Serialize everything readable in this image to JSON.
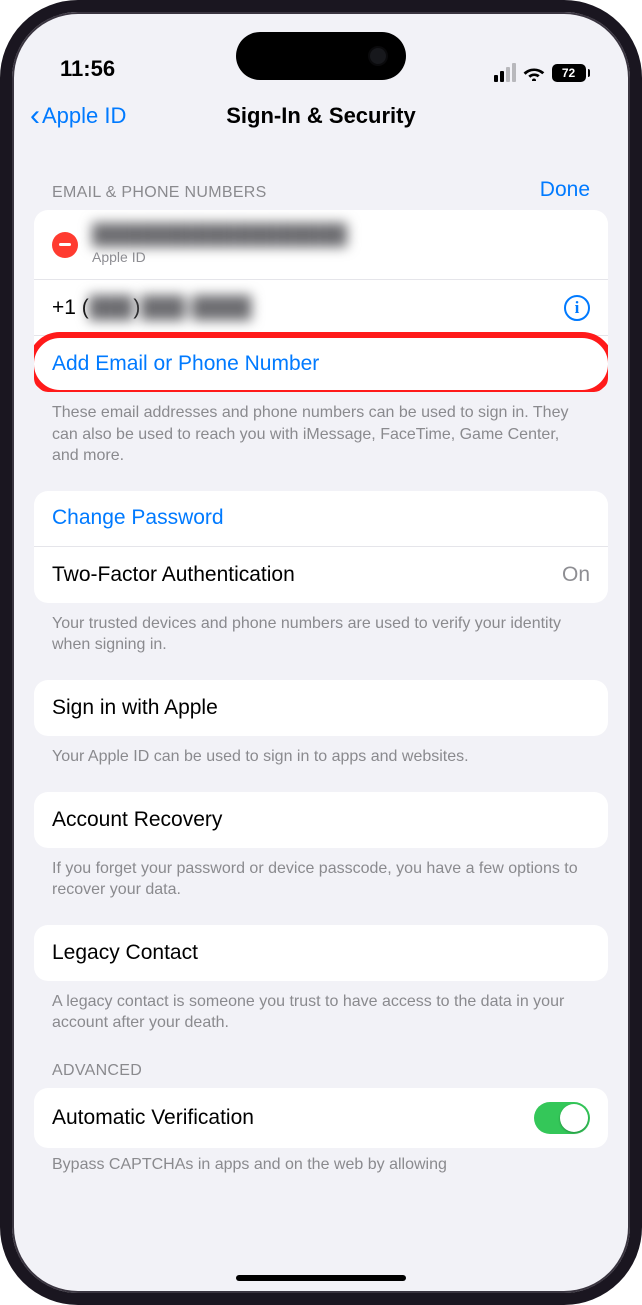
{
  "status": {
    "time": "11:56",
    "battery": "72"
  },
  "nav": {
    "back": "Apple ID",
    "title": "Sign-In & Security"
  },
  "section1": {
    "header": "Email & Phone Numbers",
    "done": "Done",
    "primary_email_blurred": "██████████████████",
    "primary_sub": "Apple ID",
    "phone_prefix": "+1 (",
    "phone_blur1": "███",
    "phone_mid": ") ",
    "phone_blur2": "███-████",
    "add": "Add Email or Phone Number",
    "footer": "These email addresses and phone numbers can be used to sign in. They can also be used to reach you with iMessage, FaceTime, Game Center, and more."
  },
  "section2": {
    "change_pw": "Change Password",
    "twofa": "Two-Factor Authentication",
    "twofa_value": "On",
    "footer": "Your trusted devices and phone numbers are used to verify your identity when signing in."
  },
  "section3": {
    "label": "Sign in with Apple",
    "footer": "Your Apple ID can be used to sign in to apps and websites."
  },
  "section4": {
    "label": "Account Recovery",
    "footer": "If you forget your password or device passcode, you have a few options to recover your data."
  },
  "section5": {
    "label": "Legacy Contact",
    "footer": "A legacy contact is someone you trust to have access to the data in your account after your death."
  },
  "advanced": {
    "header": "Advanced",
    "auto_verify": "Automatic Verification",
    "cutoff": "Bypass CAPTCHAs in apps and on the web by allowing"
  }
}
